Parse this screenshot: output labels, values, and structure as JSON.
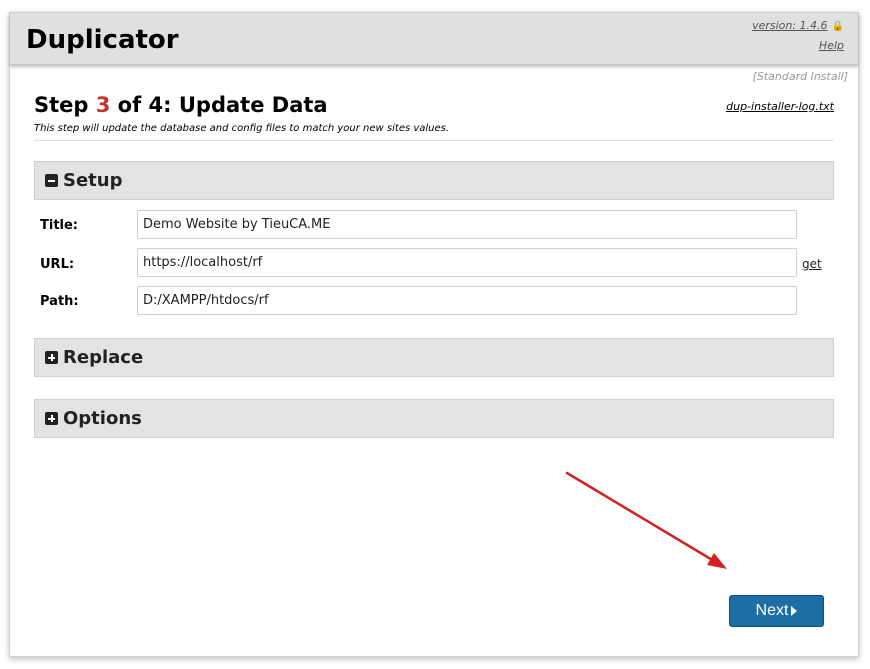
{
  "header": {
    "app_title": "Duplicator",
    "version": "version: 1.4.6",
    "help": "Help",
    "install_mode": "[Standard Install]"
  },
  "step": {
    "prefix": "Step ",
    "number": "3",
    "suffix": " of 4: Update Data",
    "description": "This step will update the database and config files to match your new sites values.",
    "log_link": "dup-installer-log.txt"
  },
  "sections": {
    "setup": {
      "label": "Setup",
      "state": "expanded"
    },
    "replace": {
      "label": "Replace",
      "state": "collapsed"
    },
    "options": {
      "label": "Options",
      "state": "collapsed"
    }
  },
  "setup_fields": {
    "title_label": "Title:",
    "title_value": "Demo Website by TieuCA.ME",
    "url_label": "URL:",
    "url_value": "https://localhost/rf",
    "get_link": "get",
    "path_label": "Path:",
    "path_value": "D:/XAMPP/htdocs/rf"
  },
  "actions": {
    "next_label": "Next"
  },
  "colors": {
    "step_number": "#c0392b",
    "next_button": "#1c6ea4",
    "annotation_arrow": "#d42020"
  },
  "icons": {
    "lock": "lock-icon",
    "collapse": "minus-square-icon",
    "expand": "plus-square-icon",
    "next": "caret-right-icon"
  }
}
